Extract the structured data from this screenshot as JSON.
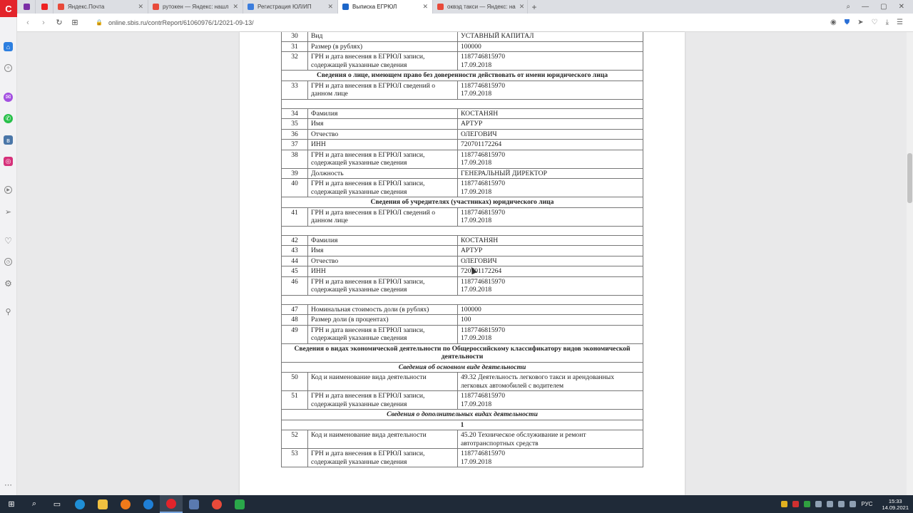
{
  "browser": {
    "tabs": [
      {
        "label": "Яндекс.Почта",
        "color": "#e84a3a"
      },
      {
        "label": "рутокен — Яндекс: нашл",
        "color": "#e84a3a"
      },
      {
        "label": "Регистрация ЮЛ/ИП",
        "color": "#3b7ddd"
      },
      {
        "label": "Выписка ЕГРЮЛ",
        "color": "#1c66c9",
        "active": true
      },
      {
        "label": "оквэд такси — Яндекс: на",
        "color": "#e84a3a"
      }
    ],
    "close_glyph": "✕",
    "new_tab_glyph": "+",
    "url": "online.sbis.ru/contrReport/61060976/1/2021-09-13/",
    "sidebar_logo": "C"
  },
  "table": {
    "rows": [
      {
        "type": "row",
        "n": "30",
        "field": "Вид",
        "value": [
          "УСТАВНЫЙ КАПИТАЛ"
        ]
      },
      {
        "type": "row",
        "n": "31",
        "field": "Размер (в рублях)",
        "value": [
          "100000"
        ]
      },
      {
        "type": "row",
        "n": "32",
        "field": "ГРН и дата внесения в ЕГРЮЛ записи, содержащей указанные сведения",
        "value": [
          "1187746815970",
          "17.09.2018"
        ]
      },
      {
        "type": "section",
        "text": "Сведения о лице, имеющем право без доверенности действовать от имени юридического лица"
      },
      {
        "type": "row",
        "n": "33",
        "field": "ГРН и дата внесения в ЕГРЮЛ сведений о данном лице",
        "value": [
          "1187746815970",
          "17.09.2018"
        ]
      },
      {
        "type": "empty"
      },
      {
        "type": "row",
        "n": "34",
        "field": "Фамилия",
        "value": [
          "КОСТАНЯН"
        ]
      },
      {
        "type": "row",
        "n": "35",
        "field": "Имя",
        "value": [
          "АРТУР"
        ]
      },
      {
        "type": "row",
        "n": "36",
        "field": "Отчество",
        "value": [
          "ОЛЕГОВИЧ"
        ]
      },
      {
        "type": "row",
        "n": "37",
        "field": "ИНН",
        "value": [
          "720701172264"
        ]
      },
      {
        "type": "row",
        "n": "38",
        "field": "ГРН и дата внесения в ЕГРЮЛ записи, содержащей указанные сведения",
        "value": [
          "1187746815970",
          "17.09.2018"
        ]
      },
      {
        "type": "row",
        "n": "39",
        "field": "Должность",
        "value": [
          "ГЕНЕРАЛЬНЫЙ ДИРЕКТОР"
        ]
      },
      {
        "type": "row",
        "n": "40",
        "field": "ГРН и дата внесения в ЕГРЮЛ записи, содержащей указанные сведения",
        "value": [
          "1187746815970",
          "17.09.2018"
        ]
      },
      {
        "type": "section",
        "text": "Сведения об учредителях (участниках) юридического лица"
      },
      {
        "type": "row",
        "n": "41",
        "field": "ГРН и дата внесения в ЕГРЮЛ сведений о данном лице",
        "value": [
          "1187746815970",
          "17.09.2018"
        ]
      },
      {
        "type": "empty"
      },
      {
        "type": "row",
        "n": "42",
        "field": "Фамилия",
        "value": [
          "КОСТАНЯН"
        ]
      },
      {
        "type": "row",
        "n": "43",
        "field": "Имя",
        "value": [
          "АРТУР"
        ]
      },
      {
        "type": "row",
        "n": "44",
        "field": "Отчество",
        "value": [
          "ОЛЕГОВИЧ"
        ]
      },
      {
        "type": "row",
        "n": "45",
        "field": "ИНН",
        "value": [
          "720701172264"
        ]
      },
      {
        "type": "row",
        "n": "46",
        "field": "ГРН и дата внесения в ЕГРЮЛ записи, содержащей указанные сведения",
        "value": [
          "1187746815970",
          "17.09.2018"
        ]
      },
      {
        "type": "empty"
      },
      {
        "type": "row",
        "n": "47",
        "field": "Номинальная стоимость доли (в рублях)",
        "value": [
          "100000"
        ]
      },
      {
        "type": "row",
        "n": "48",
        "field": "Размер доли (в процентах)",
        "value": [
          "100"
        ]
      },
      {
        "type": "row",
        "n": "49",
        "field": "ГРН и дата внесения в ЕГРЮЛ записи, содержащей указанные сведения",
        "value": [
          "1187746815970",
          "17.09.2018"
        ]
      },
      {
        "type": "section",
        "text": "Сведения о видах экономической деятельности по Общероссийскому классификатору видов экономической деятельности"
      },
      {
        "type": "subsection",
        "text": "Сведения об основном виде деятельности"
      },
      {
        "type": "row",
        "n": "50",
        "field": "Код и наименование вида деятельности",
        "value": [
          "49.32 Деятельность легкового такси и арендованных легковых автомобилей с водителем"
        ]
      },
      {
        "type": "row",
        "n": "51",
        "field": "ГРН и дата внесения в ЕГРЮЛ записи, содержащей указанные сведения",
        "value": [
          "1187746815970",
          "17.09.2018"
        ]
      },
      {
        "type": "subsection",
        "text": "Сведения о дополнительных видах деятельности"
      },
      {
        "type": "section",
        "text": "1"
      },
      {
        "type": "row",
        "n": "52",
        "field": "Код и наименование вида деятельности",
        "value": [
          "45.20 Техническое обслуживание и ремонт автотранспортных средств"
        ]
      },
      {
        "type": "row",
        "n": "53",
        "field": "ГРН и дата внесения в ЕГРЮЛ записи, содержащей указанные сведения",
        "value": [
          "1187746815970",
          "17.09.2018"
        ]
      }
    ]
  },
  "taskbar": {
    "lang": "РУС",
    "time": "15:33",
    "date": "14.09.2021"
  }
}
